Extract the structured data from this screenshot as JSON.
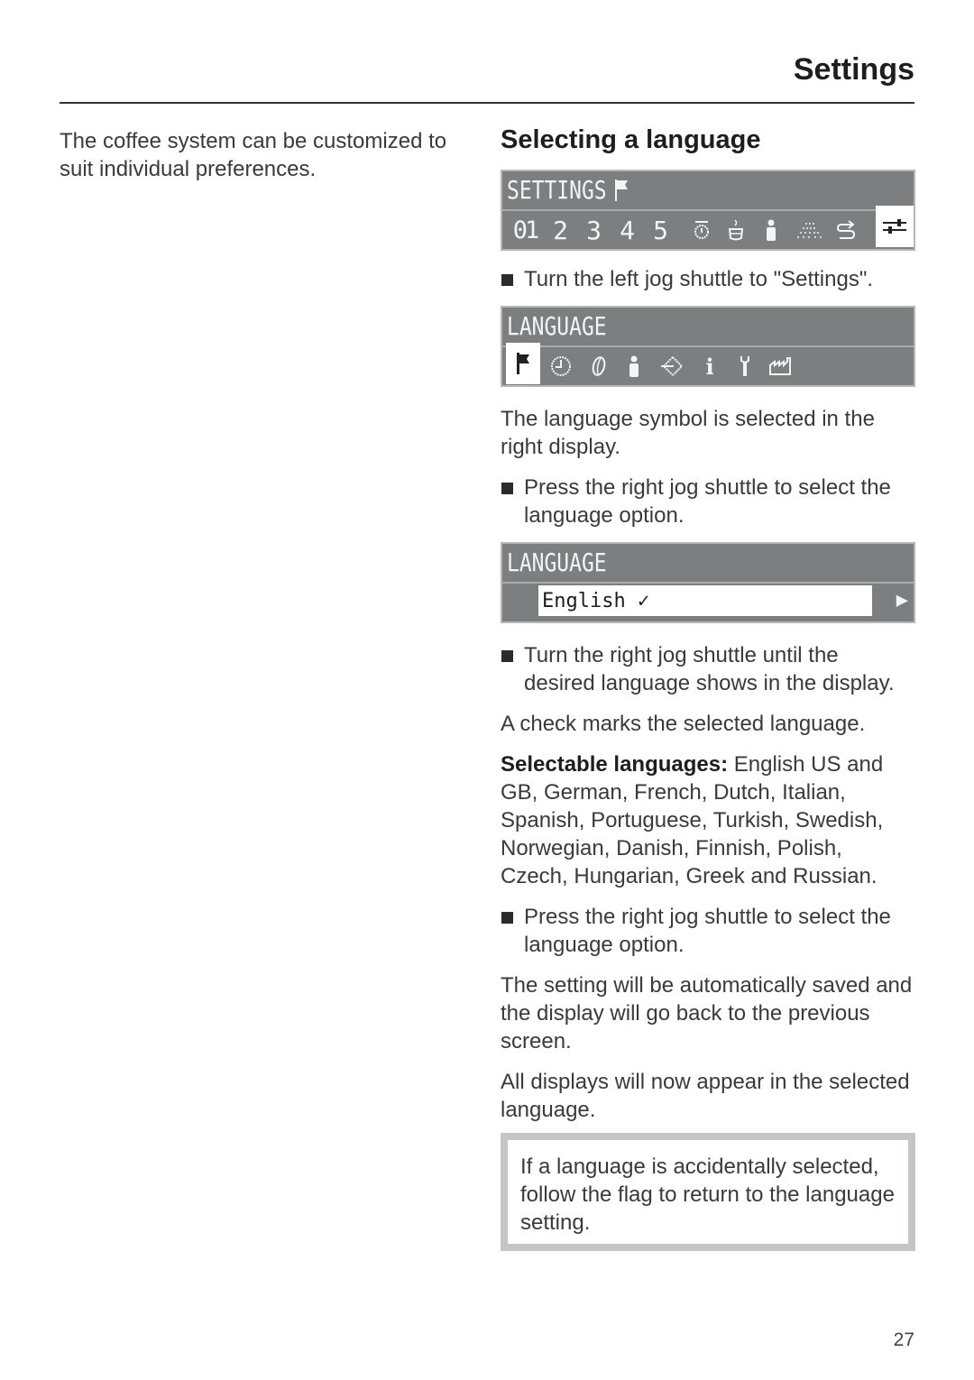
{
  "header": {
    "title": "Settings"
  },
  "intro": {
    "text": "The coffee system can be customized to suit individual preferences."
  },
  "section": {
    "heading": "Selecting a language",
    "display1": {
      "title": "SETTINGS",
      "title_icon": "flag-icon",
      "items": [
        "01",
        "2",
        "3",
        "4",
        "5"
      ],
      "icons": [
        "timer-icon",
        "cup-icon",
        "person-icon",
        "spray-icon",
        "cycle-icon",
        "settings-sliders-icon"
      ],
      "selected": "settings-sliders-icon"
    },
    "step1": "Turn the left jog shuttle to \"Settings\".",
    "display2": {
      "title": "LANGUAGE",
      "icons": [
        "flag-icon",
        "clock-icon",
        "bean-icon",
        "person-icon",
        "enter-icon",
        "info-icon",
        "wrench-icon",
        "factory-icon"
      ],
      "selected": "flag-icon"
    },
    "para1": "The language symbol is selected in the right display.",
    "step2": "Press the right jog shuttle to select the language option.",
    "display3": {
      "title": "LANGUAGE",
      "value": "English ✓",
      "arrow": "▶"
    },
    "step3": "Turn the right jog shuttle until the desired language shows in the display.",
    "para2": "A check marks the selected language.",
    "languages_label": "Selectable languages:",
    "languages_text": " English US and GB, German, French, Dutch, Italian, Spanish, Portuguese, Turkish, Swedish, Norwegian, Danish, Finnish, Polish, Czech, Hungarian, Greek and Russian.",
    "step4": "Press the right jog shuttle to select the language option.",
    "para3": "The setting will be automatically saved and the display will go back to the previous screen.",
    "para4": "All displays will now appear in the selected language.",
    "note": "If a language is accidentally selected, follow the flag to return to the language setting."
  },
  "footer": {
    "page_number": "27"
  }
}
